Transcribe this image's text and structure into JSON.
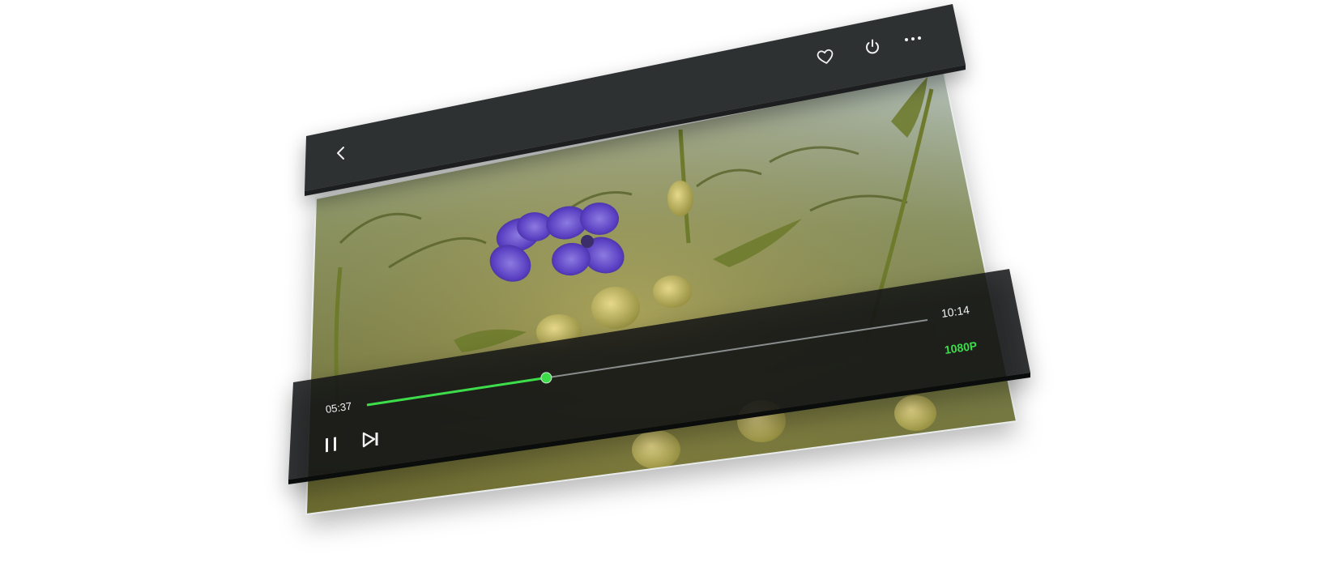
{
  "player": {
    "current_time": "05:37",
    "total_time": "10:14",
    "quality": "1080P",
    "progress": 0.32
  },
  "top_bar": {
    "icons": [
      "back-icon",
      "heart-icon",
      "power-icon",
      "more-icon"
    ]
  },
  "controls": {
    "icons": [
      "pause-icon",
      "skip-next-icon"
    ]
  },
  "colors": {
    "accent": "#3ddc4a",
    "bar": "#2e3132",
    "bottom_bar": "#141516"
  }
}
